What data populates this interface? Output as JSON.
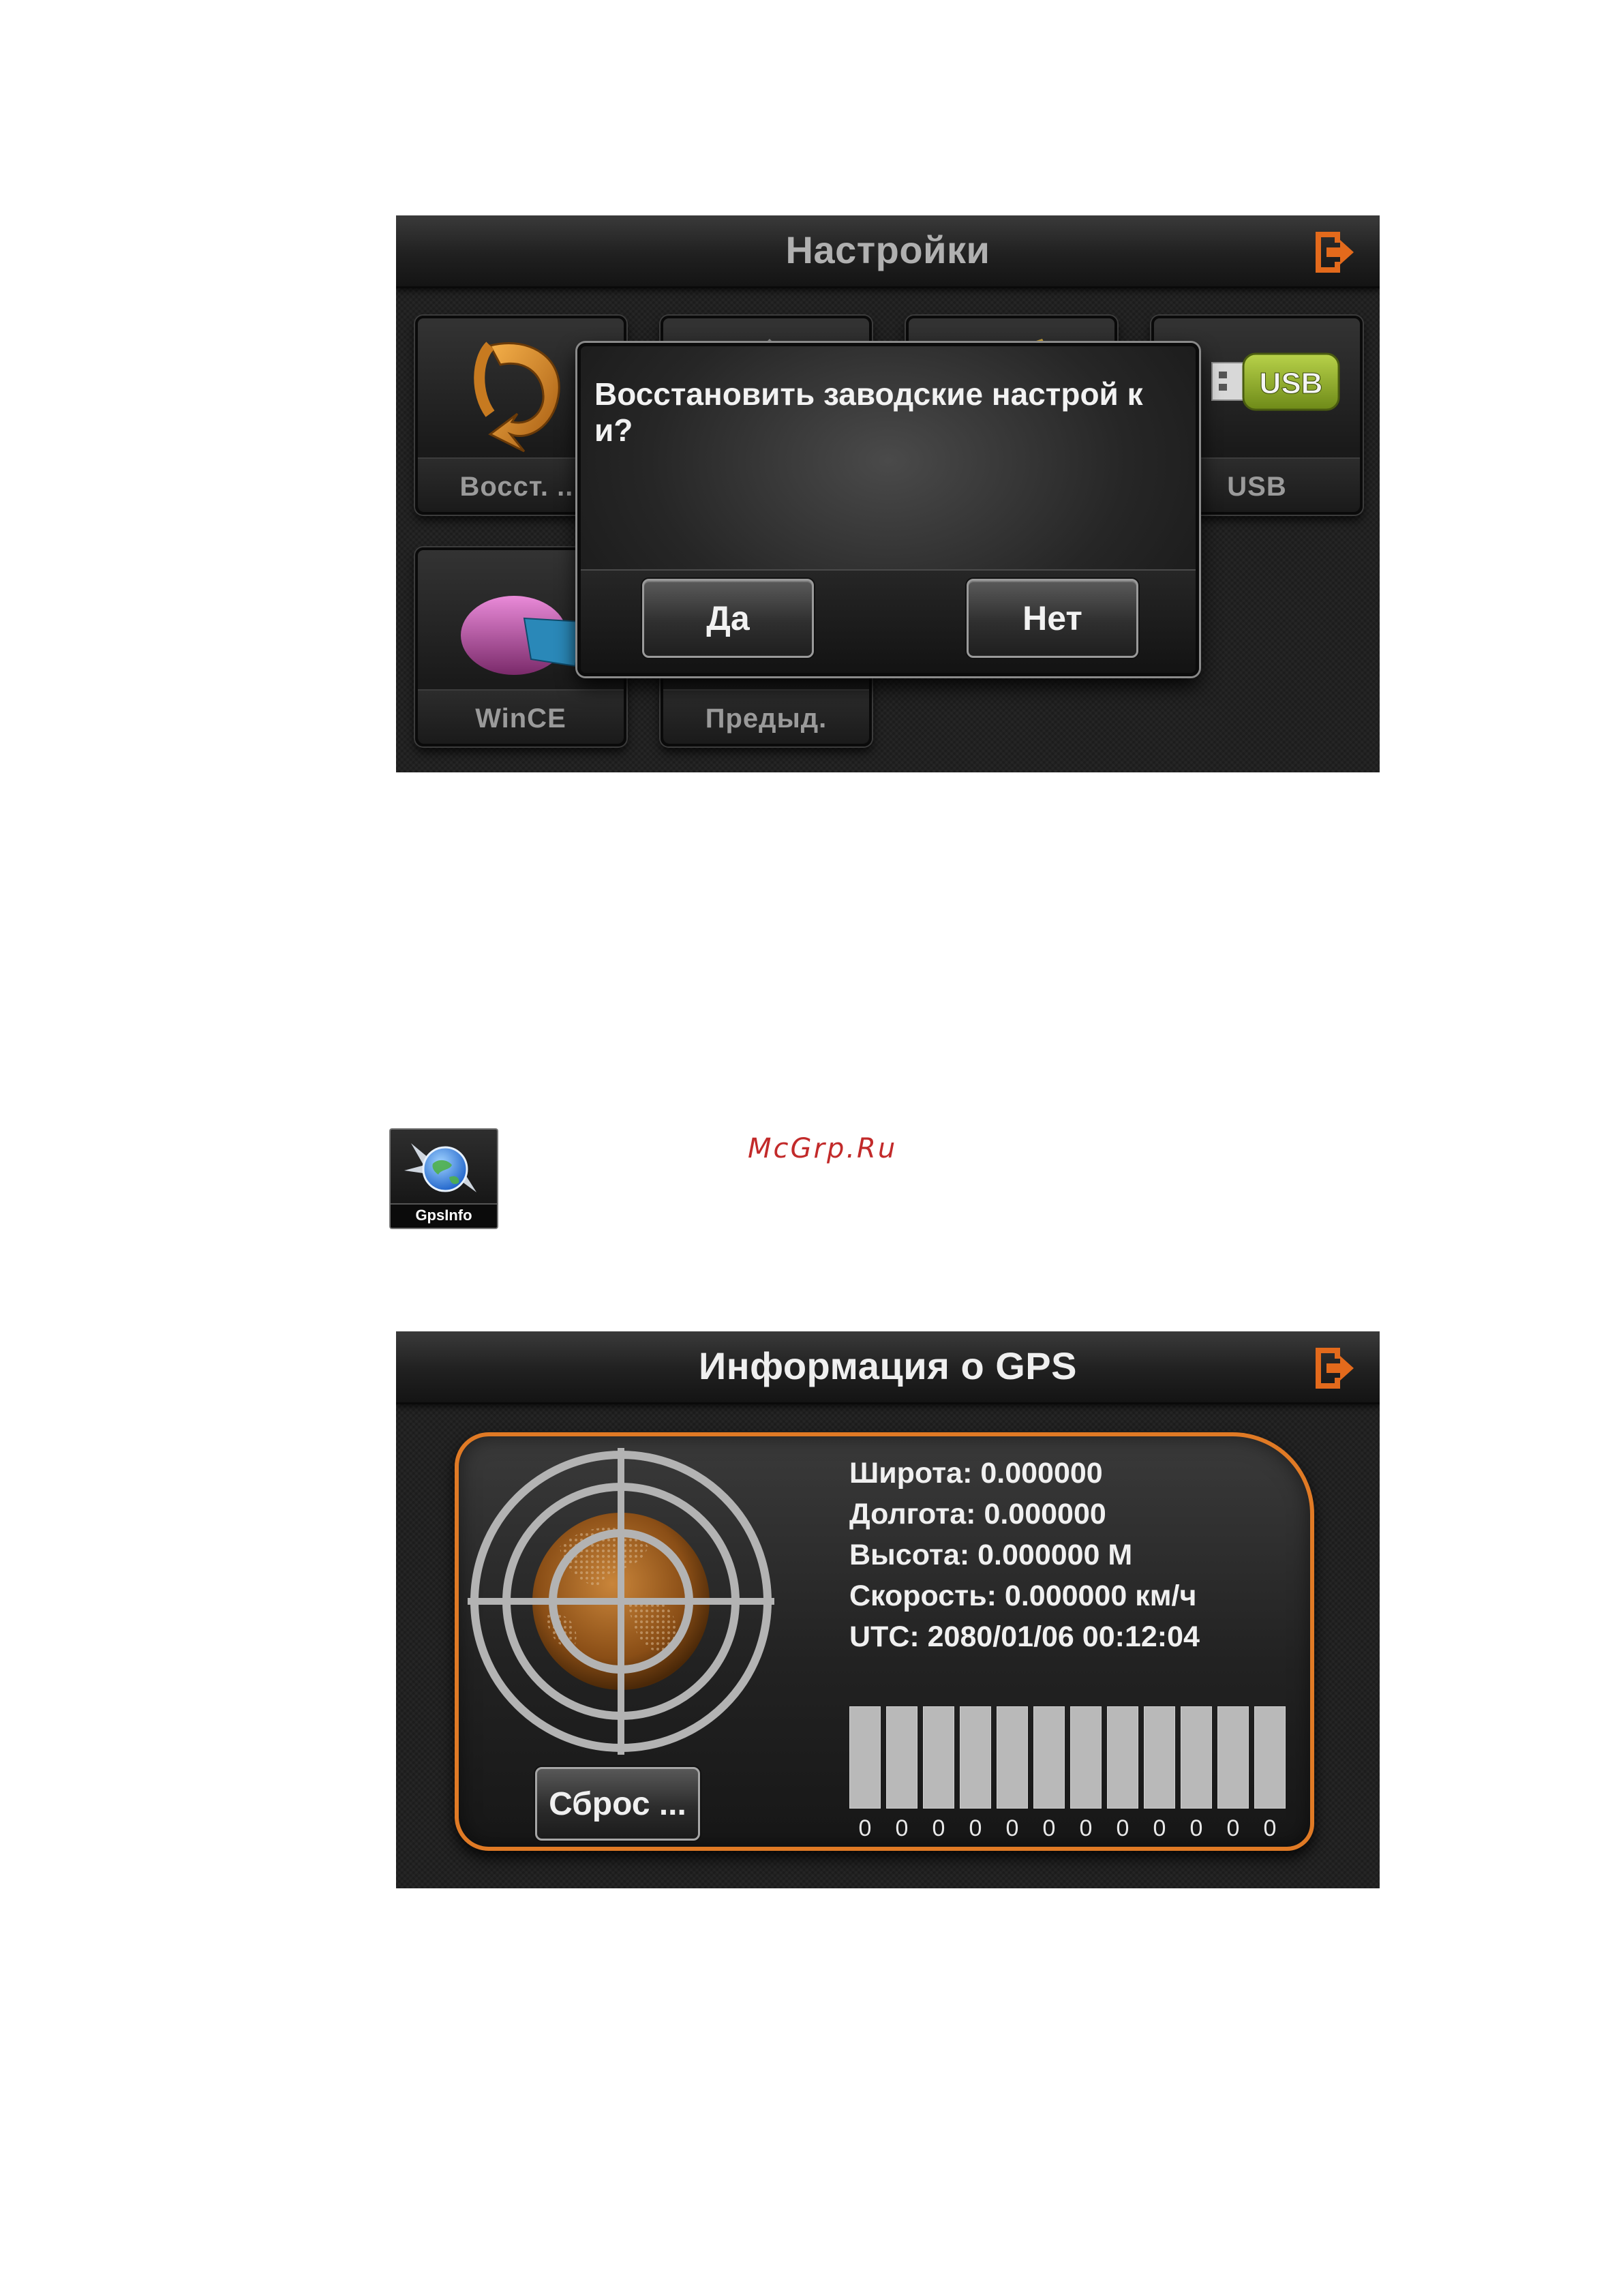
{
  "settings_screen": {
    "title": "Настройки",
    "tiles": [
      {
        "label": "Восст. ...",
        "icon": "restore-icon"
      },
      {
        "label": "",
        "icon": "tool-icon"
      },
      {
        "label": "",
        "icon": "card-icon"
      },
      {
        "label": "USB",
        "icon": "usb-icon"
      },
      {
        "label": "WinCE",
        "icon": "pie-chart-icon"
      },
      {
        "label": "Предыд.",
        "icon": "previous-icon"
      }
    ],
    "usb_icon_text": "USB",
    "dialog": {
      "message": "Восстановить заводские настрой ки?",
      "yes_label": "Да",
      "no_label": "Нет"
    }
  },
  "gps_icon": {
    "label": "GpsInfo"
  },
  "watermark": "McGrp.Ru",
  "gps_screen": {
    "title": "Информация о GPS",
    "latitude": "Широта: 0.000000",
    "longitude": "Долгота: 0.000000",
    "altitude": "Высота: 0.000000 M",
    "speed": "Скорость: 0.000000 км/ч",
    "utc": "UTC: 2080/01/06 00:12:04",
    "reset_label": "Сброс ...",
    "satellite_signals": [
      0,
      0,
      0,
      0,
      0,
      0,
      0,
      0,
      0,
      0,
      0,
      0
    ]
  },
  "colors": {
    "accent": "#e07a25",
    "background": "#1c1c1c",
    "watermark": "#c22a2a"
  }
}
